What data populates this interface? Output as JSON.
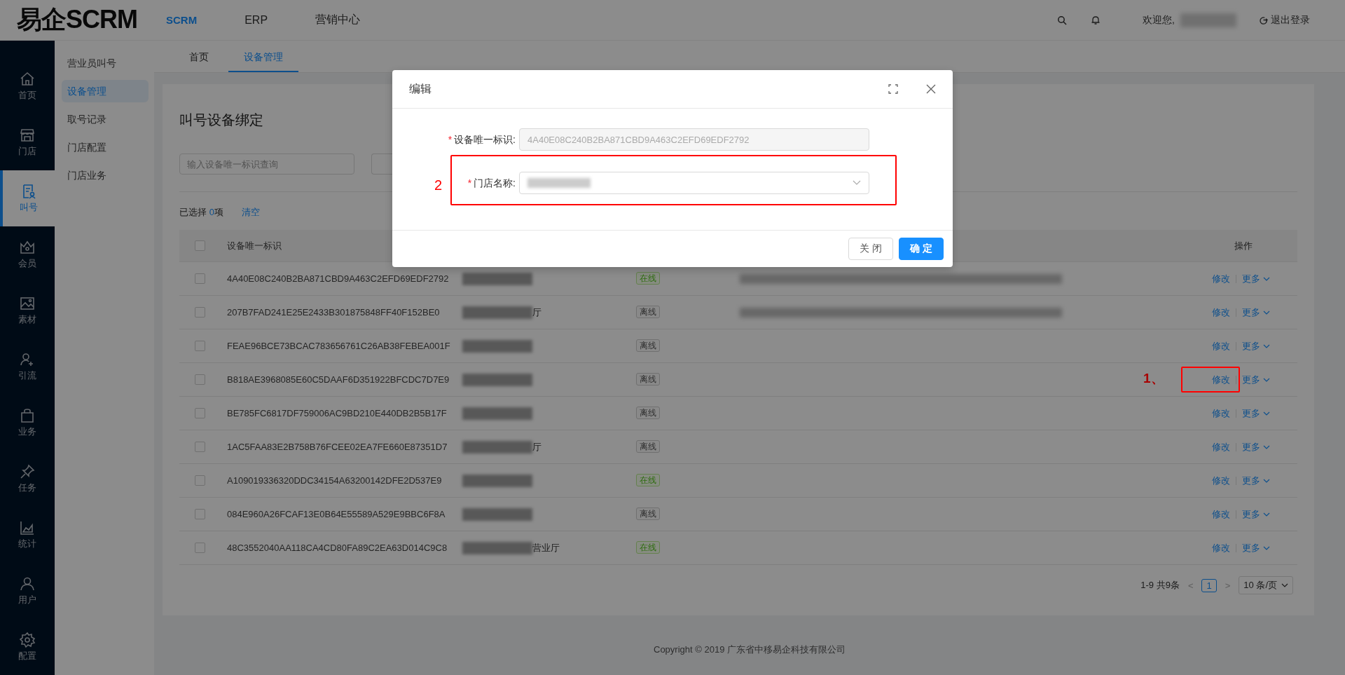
{
  "header": {
    "logo": "易企SCRM",
    "nav": [
      {
        "label": "SCRM",
        "selected": true
      },
      {
        "label": "ERP",
        "selected": false
      },
      {
        "label": "营销中心",
        "selected": false
      }
    ],
    "welcome": "欢迎您,",
    "logout": "退出登录"
  },
  "rail": [
    {
      "label": "首页",
      "selected": false
    },
    {
      "label": "门店",
      "selected": false
    },
    {
      "label": "叫号",
      "selected": true
    },
    {
      "label": "会员",
      "selected": false
    },
    {
      "label": "素材",
      "selected": false
    },
    {
      "label": "引流",
      "selected": false
    },
    {
      "label": "业务",
      "selected": false
    },
    {
      "label": "任务",
      "selected": false
    },
    {
      "label": "统计",
      "selected": false
    },
    {
      "label": "用户",
      "selected": false
    },
    {
      "label": "配置",
      "selected": false
    }
  ],
  "subnav": [
    {
      "label": "营业员叫号",
      "selected": false
    },
    {
      "label": "设备管理",
      "selected": true
    },
    {
      "label": "取号记录",
      "selected": false
    },
    {
      "label": "门店配置",
      "selected": false
    },
    {
      "label": "门店业务",
      "selected": false
    }
  ],
  "tabs": [
    {
      "label": "首页",
      "selected": false
    },
    {
      "label": "设备管理",
      "selected": true
    }
  ],
  "page_title": "叫号设备绑定",
  "filters": [
    {
      "placeholder": "输入设备唯一标识查询"
    },
    {
      "kind": "partial"
    }
  ],
  "selection": {
    "prefix": "已选择 ",
    "count": "0",
    "suffix": "项",
    "clear": "清空"
  },
  "table": {
    "header_checked": false,
    "columns": [
      {
        "label": "设备唯一标识"
      },
      {
        "label": "操作"
      }
    ],
    "rows": [
      {
        "checked": false,
        "device_id": "4A40E08C240B2BA871CBD9A463C2EFD69EDF2792",
        "status": {
          "label": "在线",
          "kind": "online"
        },
        "description_redacted": true,
        "edit": "修改",
        "more": "更多"
      },
      {
        "checked": false,
        "device_id": "207B7FAD241E25E2433B301875848FF40F152BE0",
        "store_tail": "厅",
        "status": {
          "label": "离线",
          "kind": "offline"
        },
        "description_redacted": true,
        "edit": "修改",
        "more": "更多"
      },
      {
        "checked": false,
        "device_id": "FEAE96BCE73BCAC783656761C26AB38FEBEA001F",
        "status": {
          "label": "离线",
          "kind": "offline"
        },
        "edit": "修改",
        "more": "更多"
      },
      {
        "checked": false,
        "device_id": "B818AE3968085E60C5DAAF6D351922BFCDC7D7E9",
        "status": {
          "label": "离线",
          "kind": "offline"
        },
        "edit": "修改",
        "more": "更多",
        "annotation": "1、"
      },
      {
        "checked": false,
        "device_id": "BE785FC6817DF759006AC9BD210E440DB2B5B17F",
        "status": {
          "label": "离线",
          "kind": "offline"
        },
        "edit": "修改",
        "more": "更多"
      },
      {
        "checked": false,
        "device_id": "1AC5FAA83E2B758B76FCEE02EA7FE660E87351D7",
        "store_tail": "厅",
        "status": {
          "label": "离线",
          "kind": "offline"
        },
        "edit": "修改",
        "more": "更多"
      },
      {
        "checked": false,
        "device_id": "A109019336320DDC34154A63200142DFE2D537E9",
        "status": {
          "label": "在线",
          "kind": "online"
        },
        "edit": "修改",
        "more": "更多"
      },
      {
        "checked": false,
        "device_id": "084E960A26FCAF13E0B64E55589A529E9BBC6F8A",
        "status": {
          "label": "离线",
          "kind": "offline"
        },
        "edit": "修改",
        "more": "更多"
      },
      {
        "checked": false,
        "device_id": "48C3552040AA118CA4CD80FA89C2EA63D014C9C8",
        "store_tail": "营业厅",
        "status": {
          "label": "在线",
          "kind": "online"
        },
        "edit": "修改",
        "more": "更多"
      }
    ]
  },
  "pagination": {
    "summary": "1-9 共9条",
    "prev": "<",
    "pages": [
      {
        "label": "1",
        "selected": true
      }
    ],
    "next": ">",
    "page_size": "10 条/页"
  },
  "footer": {
    "copyright": "Copyright © 2019 广东省中移易企科技有限公司"
  },
  "dialog": {
    "title": "编辑",
    "fields": [
      {
        "label": "设备唯一标识:",
        "required_mark": "*",
        "kind": "input",
        "value": "4A40E08C240B2BA871CBD9A463C2EFD69EDF2792",
        "disabled": true
      },
      {
        "label": "门店名称:",
        "required_mark": "*",
        "kind": "select",
        "disabled": false,
        "annotation": "2"
      }
    ],
    "buttons": [
      {
        "label": "关 闭",
        "primary": false
      },
      {
        "label": "确 定",
        "primary": true
      }
    ]
  }
}
